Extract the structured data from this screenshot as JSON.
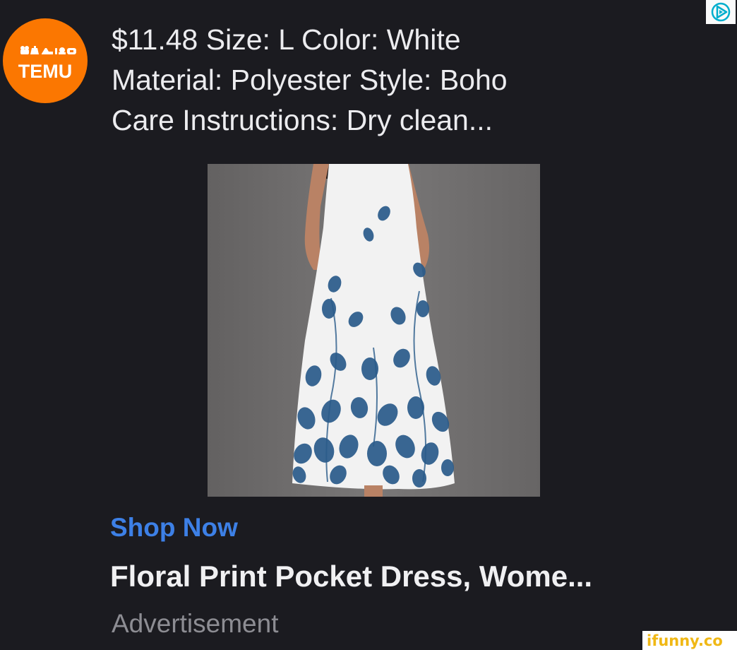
{
  "ad_choices": {
    "icon": "ad-choices-icon",
    "color": "#00aecd"
  },
  "brand": {
    "name": "TEMU",
    "color": "#fb7701"
  },
  "description": {
    "line1": "$11.48 Size: L Color: White",
    "line2": "Material: Polyester Style: Boho",
    "line3": "Care Instructions: Dry clean..."
  },
  "product_image": {
    "alt": "white maxi dress with blue floral print"
  },
  "cta": {
    "label": "Shop Now",
    "color": "#3d80e6"
  },
  "product": {
    "title": "Floral Print Pocket Dress, Wome..."
  },
  "sponsor_label": "Advertisement",
  "watermark": {
    "text": "ifunny.co"
  }
}
